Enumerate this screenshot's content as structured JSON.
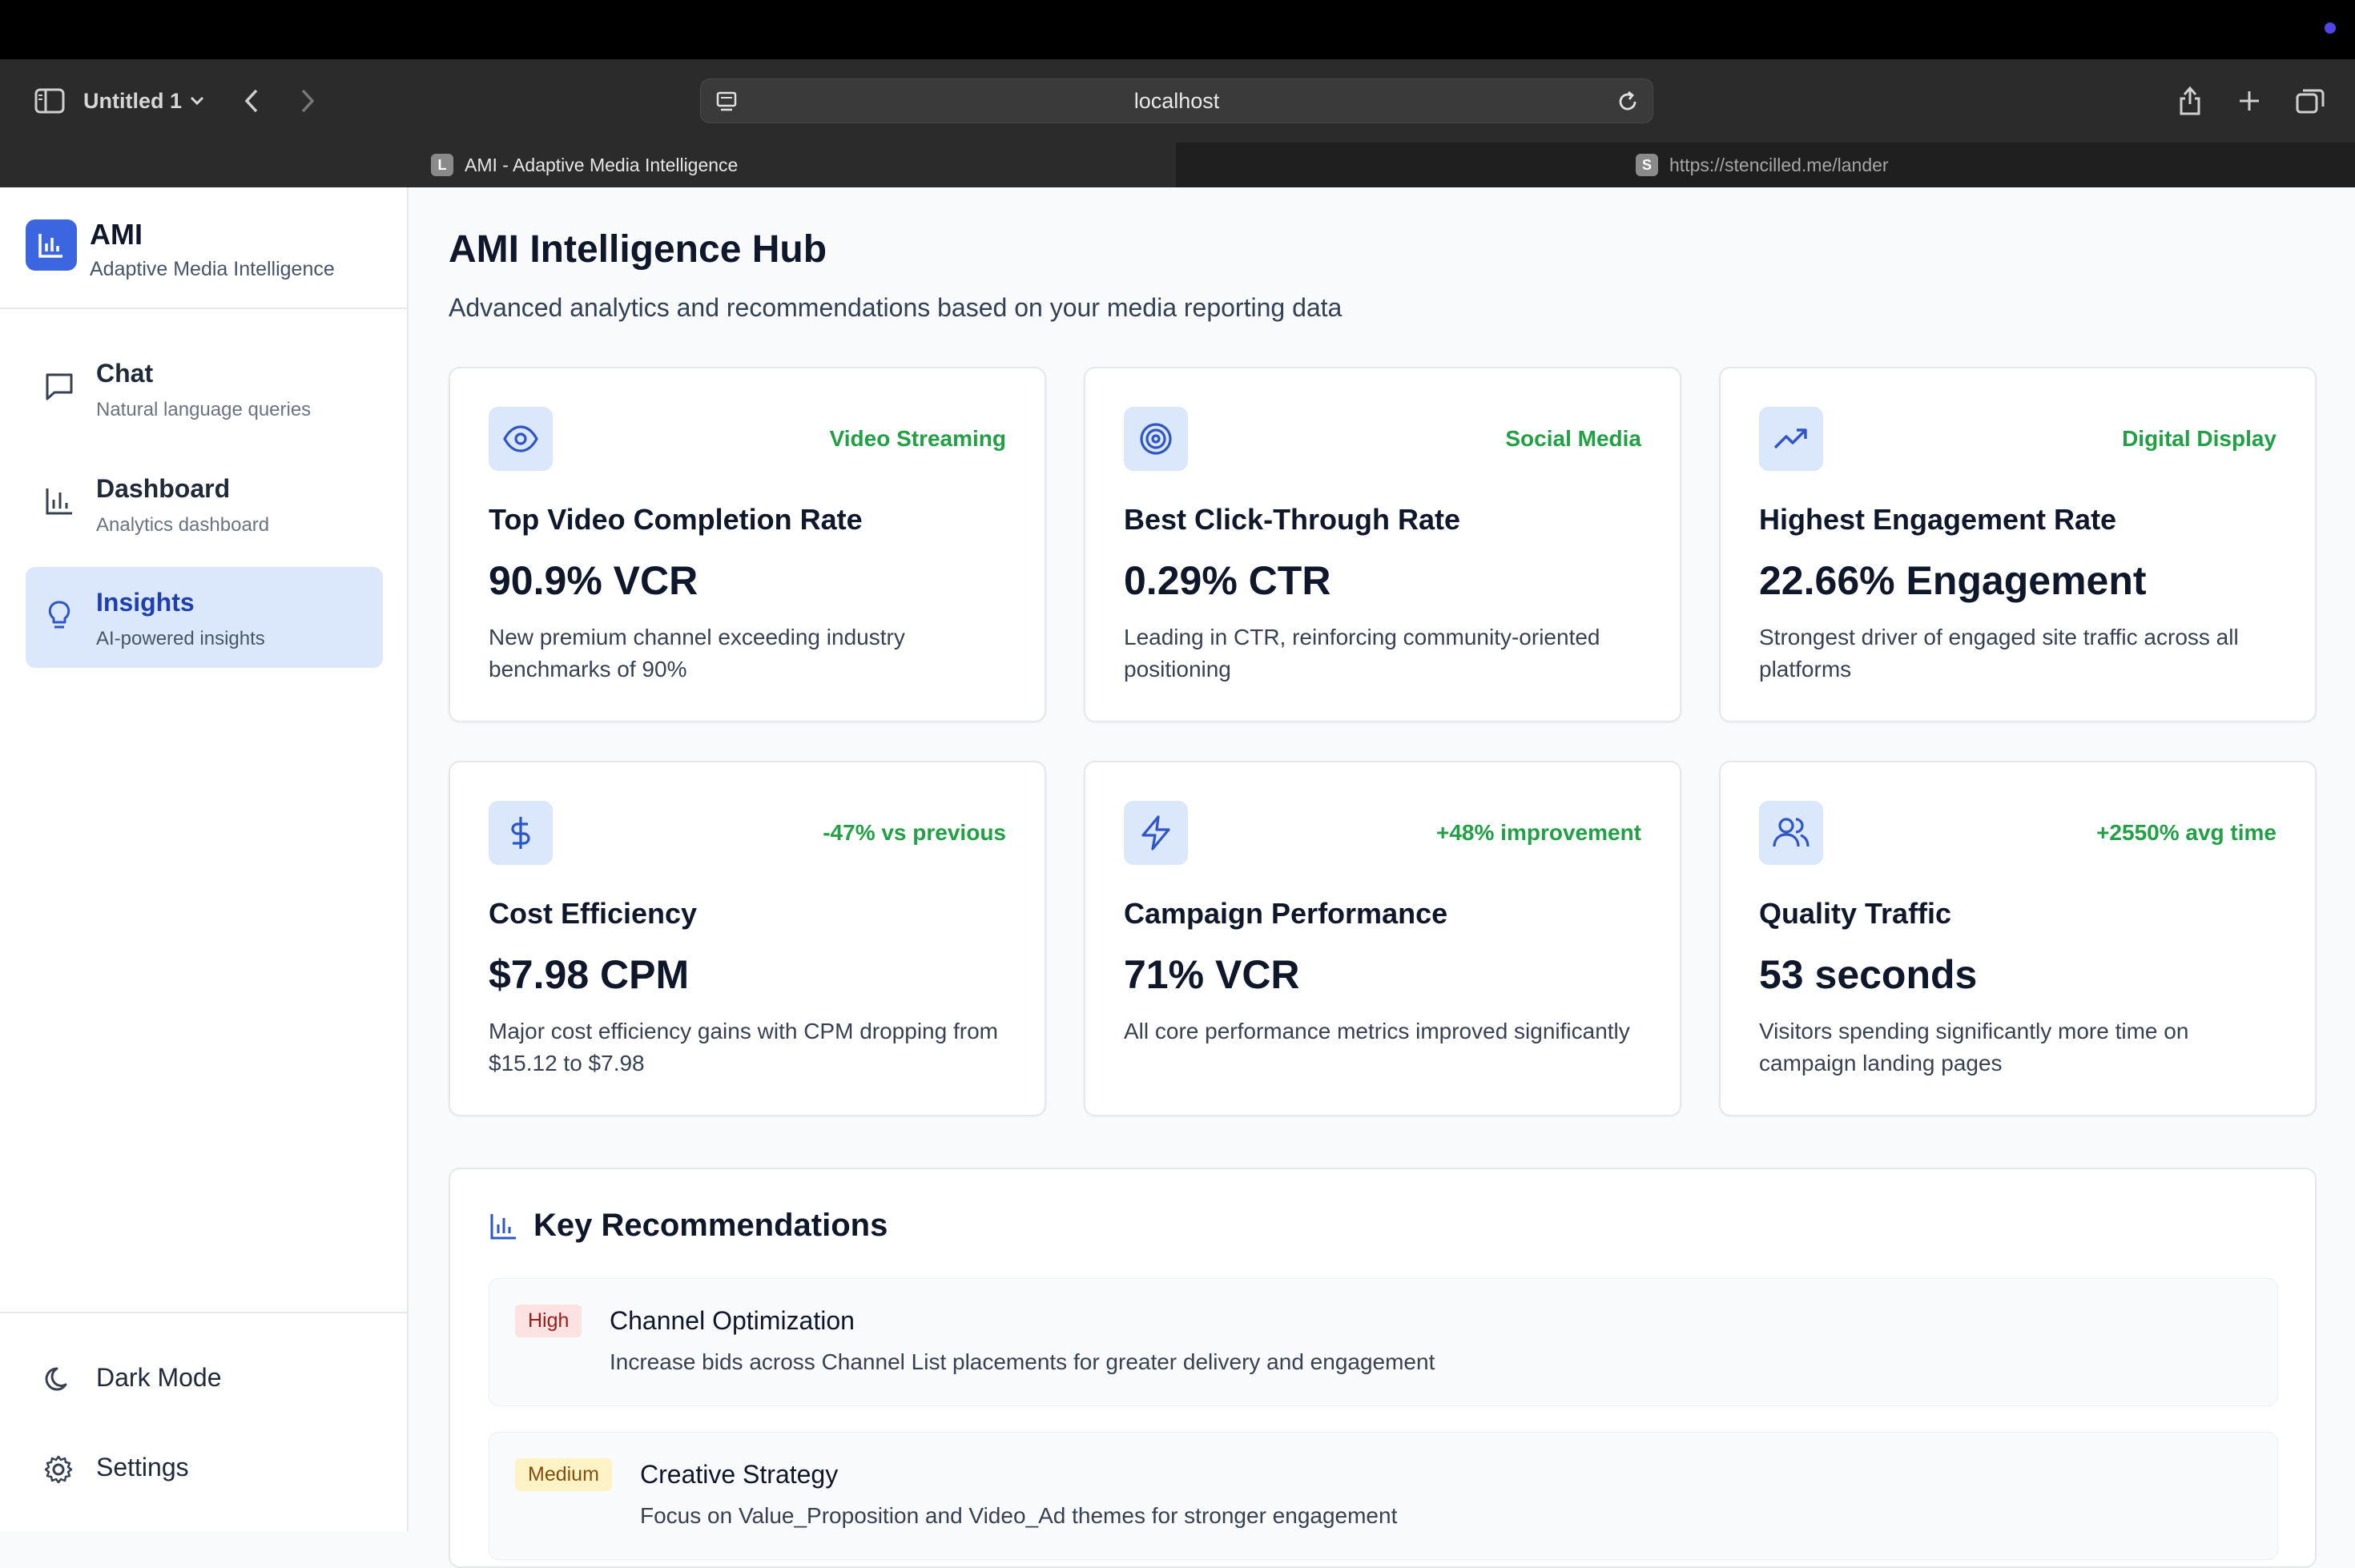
{
  "browser": {
    "window_title": "Untitled 1",
    "url": "localhost",
    "tabs": [
      {
        "favicon": "L",
        "label": "AMI - Adaptive Media Intelligence"
      },
      {
        "favicon": "S",
        "label": "https://stencilled.me/lander"
      }
    ]
  },
  "brand": {
    "name": "AMI",
    "subtitle": "Adaptive Media Intelligence"
  },
  "nav": [
    {
      "label": "Chat",
      "sub": "Natural language queries",
      "icon": "message-square-icon"
    },
    {
      "label": "Dashboard",
      "sub": "Analytics dashboard",
      "icon": "bar-chart-icon"
    },
    {
      "label": "Insights",
      "sub": "AI-powered insights",
      "icon": "lightbulb-icon"
    }
  ],
  "footer": [
    {
      "label": "Dark Mode",
      "icon": "moon-icon"
    },
    {
      "label": "Settings",
      "icon": "gear-icon"
    }
  ],
  "page": {
    "title": "AMI Intelligence Hub",
    "subtitle": "Advanced analytics and recommendations based on your media reporting data"
  },
  "cards": [
    {
      "icon": "eye-icon",
      "tag": "Video Streaming",
      "title": "Top Video Completion Rate",
      "value": "90.9% VCR",
      "desc": "New premium channel exceeding industry benchmarks of 90%"
    },
    {
      "icon": "target-icon",
      "tag": "Social Media",
      "title": "Best Click-Through Rate",
      "value": "0.29% CTR",
      "desc": "Leading in CTR, reinforcing community-oriented positioning"
    },
    {
      "icon": "trending-up-icon",
      "tag": "Digital Display",
      "title": "Highest Engagement Rate",
      "value": "22.66% Engagement",
      "desc": "Strongest driver of engaged site traffic across all platforms"
    },
    {
      "icon": "dollar-icon",
      "tag": "-47% vs previous",
      "title": "Cost Efficiency",
      "value": "$7.98 CPM",
      "desc": "Major cost efficiency gains with CPM dropping from $15.12 to $7.98"
    },
    {
      "icon": "lightning-icon",
      "tag": "+48% improvement",
      "title": "Campaign Performance",
      "value": "71% VCR",
      "desc": "All core performance metrics improved significantly"
    },
    {
      "icon": "users-icon",
      "tag": "+2550% avg time",
      "title": "Quality Traffic",
      "value": "53 seconds",
      "desc": "Visitors spending significantly more time on campaign landing pages"
    }
  ],
  "recommendations": {
    "title": "Key Recommendations",
    "items": [
      {
        "priority": "High",
        "title": "Channel Optimization",
        "desc": "Increase bids across Channel List placements for greater delivery and engagement"
      },
      {
        "priority": "Medium",
        "title": "Creative Strategy",
        "desc": "Focus on Value_Proposition and Video_Ad themes for stronger engagement"
      }
    ]
  },
  "colors": {
    "accent": "#3b66e0",
    "tag_green": "#22a045",
    "active_nav_bg": "#dbe7fb"
  }
}
